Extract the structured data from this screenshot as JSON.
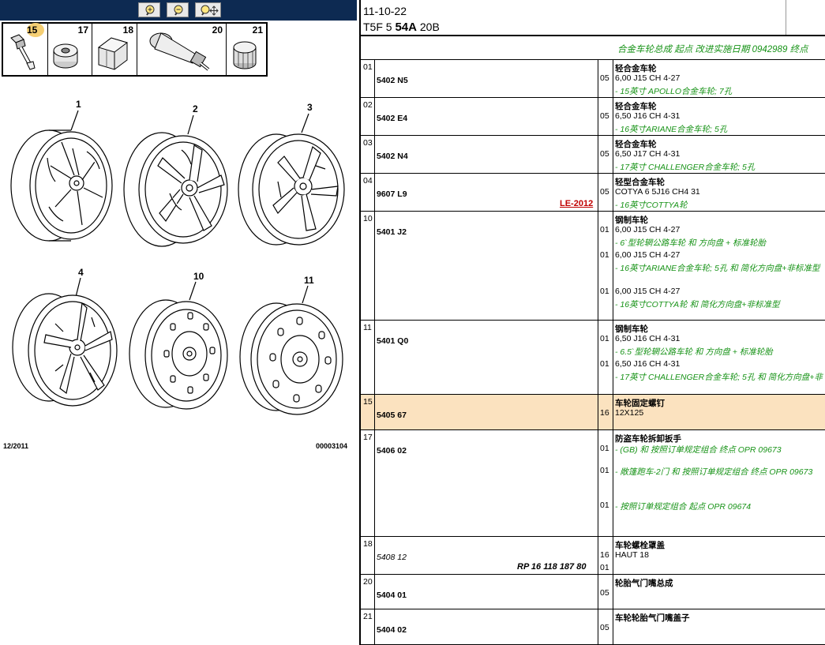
{
  "header": {
    "date": "11-10-22",
    "model_code": "T5F 5",
    "model_bold": "54A",
    "model_suffix": "20B"
  },
  "banner": "合金车轮总成 起点 改进实施日期 0942989 终点",
  "toolbar": {
    "zoom_in": "zoom-in-icon",
    "zoom_out": "zoom-out-icon",
    "pan": "pan-zoom-icon"
  },
  "thumbnails": [
    {
      "num": "15",
      "selected": true
    },
    {
      "num": "17"
    },
    {
      "num": "18"
    },
    {
      "num": "20"
    },
    {
      "num": "21"
    }
  ],
  "diagram": {
    "labels": [
      "1",
      "2",
      "3",
      "4",
      "10",
      "11"
    ],
    "footer_left": "12/2011",
    "footer_right": "00003104"
  },
  "colors": {
    "toolbar": "#0d2a52",
    "highlight": "#fbe2bf",
    "green": "#179317",
    "red": "#c00000"
  },
  "rows": [
    {
      "idx": "01",
      "ref": "5402 N5",
      "title": "轻合金车轮",
      "entries": [
        {
          "qty": "05",
          "spec": "6,00 J15 CH 4-27",
          "note": "- 15英寸 APOLLO合金车轮; 7孔"
        }
      ]
    },
    {
      "idx": "02",
      "ref": "5402 E4",
      "title": "轻合金车轮",
      "entries": [
        {
          "qty": "05",
          "spec": "6,50 J16 CH 4-31",
          "note": "- 16英寸ARIANE合金车轮; 5孔"
        }
      ]
    },
    {
      "idx": "03",
      "ref": "5402 N4",
      "title": "轻合金车轮",
      "entries": [
        {
          "qty": "05",
          "spec": "6,50 J17 CH 4-31",
          "note": "- 17英寸 CHALLENGER合金车轮; 5孔"
        }
      ]
    },
    {
      "idx": "04",
      "ref": "9607 L9",
      "title": "轻型合金车轮",
      "flag": "LE-2012",
      "entries": [
        {
          "qty": "05",
          "spec": "COTYA 6 5J16 CH4 31",
          "note": "- 16英寸COTTYA轮"
        }
      ]
    },
    {
      "idx": "10",
      "ref": "5401 J2",
      "title": "钢制车轮",
      "entries": [
        {
          "qty": "01",
          "spec": "6,00 J15 CH 4-27",
          "note": "- 6`型轮辋公路车轮 和 方向盘 + 标准轮胎"
        },
        {
          "qty": "01",
          "spec": "6,00 J15 CH 4-27",
          "note": "- 16英寸ARIANE合金车轮; 5孔 和 简化方向盘+非标准型"
        },
        {
          "qty": "01",
          "spec": "6,00 J15 CH 4-27",
          "note": "- 16英寸COTTYA轮 和 简化方向盘+非标准型"
        }
      ]
    },
    {
      "idx": "11",
      "ref": "5401 Q0",
      "title": "钢制车轮",
      "entries": [
        {
          "qty": "01",
          "spec": "6,50 J16 CH 4-31",
          "note": "- 6.5`型轮辋公路车轮 和 方向盘 + 标准轮胎"
        },
        {
          "qty": "01",
          "spec": "6,50 J16 CH 4-31",
          "note": "- 17英寸 CHALLENGER合金车轮; 5孔 和 简化方向盘+非"
        }
      ]
    },
    {
      "idx": "15",
      "ref": "5405 67",
      "title": "车轮固定螺钉",
      "highlight": true,
      "entries": [
        {
          "qty": "16",
          "spec": "12X125"
        }
      ]
    },
    {
      "idx": "17",
      "ref": "5406 02",
      "title": "防盗车轮拆卸扳手",
      "entries": [
        {
          "qty": "01",
          "note": "- (GB) 和 按照订单规定组合 终点 OPR 09673"
        },
        {
          "qty": "01",
          "note": "- 敞篷跑车-2门 和 按照订单规定组合 终点 OPR 09673"
        },
        {
          "qty": "01",
          "note": "- 按照订单规定组合 起点 OPR 09674"
        }
      ]
    },
    {
      "idx": "18",
      "ref": "5408 12",
      "ref_italic": true,
      "title": "车轮螺栓罩盖",
      "rp": "RP 16 118 187 80",
      "entries": [
        {
          "qty": "16",
          "spec": "HAUT 18"
        },
        {
          "qty": "01"
        }
      ]
    },
    {
      "idx": "20",
      "ref": "5404 01",
      "title": "轮胎气门嘴总成",
      "entries": [
        {
          "qty": "05"
        }
      ]
    },
    {
      "idx": "21",
      "ref": "5404 02",
      "title": "车轮轮胎气门嘴盖子",
      "entries": [
        {
          "qty": "05"
        }
      ]
    }
  ]
}
